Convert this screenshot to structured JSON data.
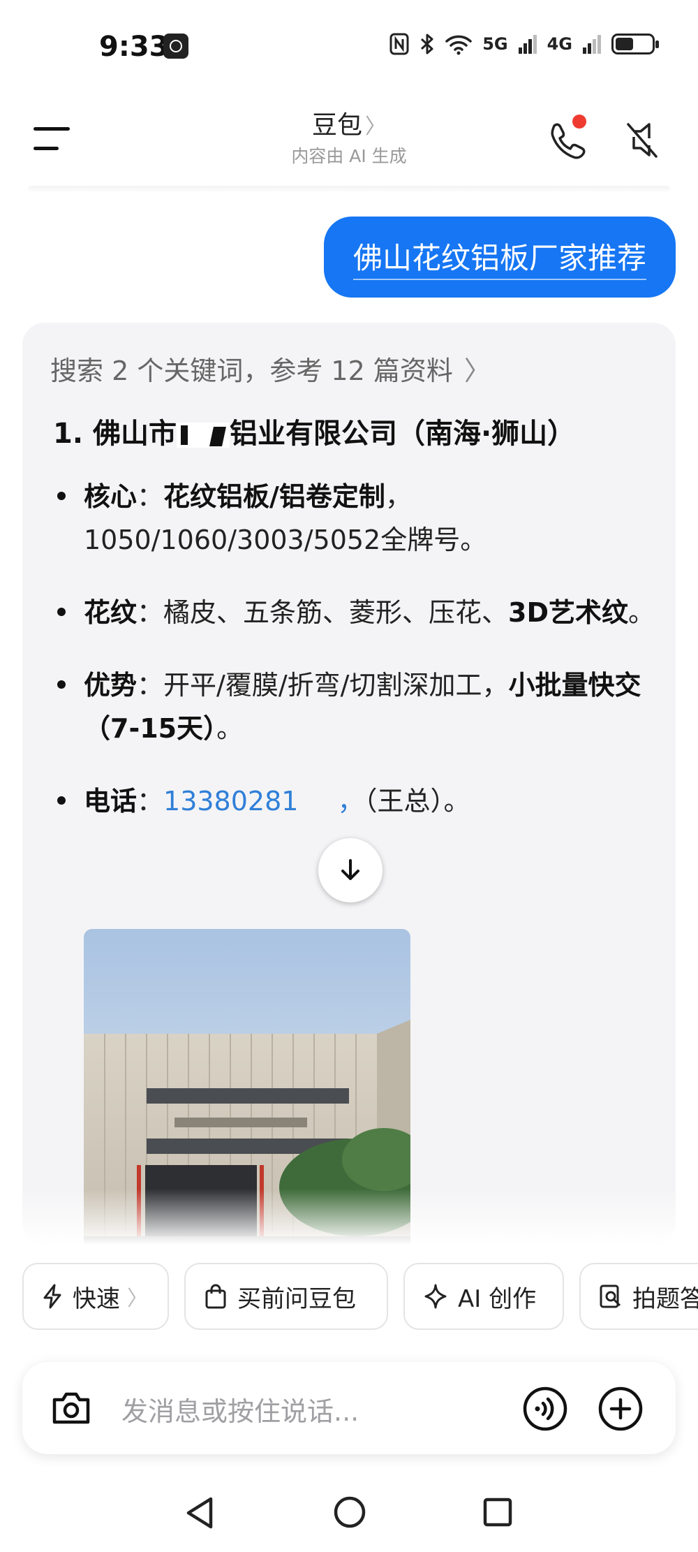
{
  "status_bar": {
    "time": "9:33",
    "network_1": "5G",
    "network_2": "4G"
  },
  "header": {
    "title": "豆包",
    "title_chevron": "〉",
    "subtitle": "内容由 AI 生成"
  },
  "user_message": "佛山花纹铝板厂家推荐",
  "reply": {
    "reference_line": "搜索 2 个关键词，参考 12 篇资料",
    "reference_chevron": "〉",
    "item_title_prefix": "1. 佛山市",
    "item_title_suffix": "铝业有限公司（南海·狮山）",
    "bullets": {
      "core_label": "核心",
      "core_bold": "花纹铝板/铝卷定制",
      "core_rest": "，1050/1060/3003/5052全牌号。",
      "pattern_label": "花纹",
      "pattern_text": "橘皮、五条筋、菱形、压花、",
      "pattern_bold": "3D艺术纹",
      "pattern_end": "。",
      "advantage_label": "优势",
      "advantage_text": "开平/覆膜/折弯/切割深加工，",
      "advantage_bold": "小批量快交（7-15天）",
      "advantage_end": "。",
      "phone_label": "电话",
      "phone_number": "13380281",
      "phone_sep": "，",
      "phone_contact": "（王总）。"
    },
    "colon": "："
  },
  "chips": [
    {
      "label": "快速",
      "chevron": "〉",
      "icon": "lightning-icon"
    },
    {
      "label": "买前问豆包",
      "icon": "shopping-bag-icon"
    },
    {
      "label": "AI 创作",
      "icon": "sparkle-icon"
    },
    {
      "label": "拍题答疑",
      "icon": "photo-question-icon"
    }
  ],
  "input": {
    "placeholder": "发消息或按住说话..."
  },
  "colors": {
    "accent": "#1676f3",
    "link": "#2f7fd8",
    "card_bg": "#f4f4f6",
    "badge": "#ef3b2f"
  }
}
